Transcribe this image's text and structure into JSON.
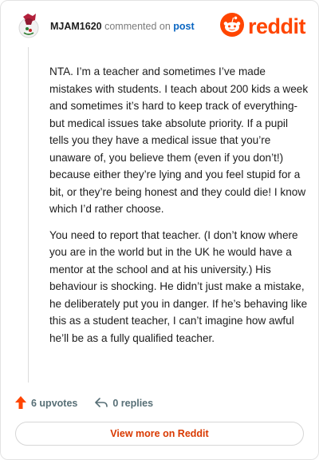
{
  "comment": {
    "username": "MJAM1620",
    "action_text": "commented on",
    "post_link": "post",
    "paragraphs": [
      "NTA. I’m a teacher and sometimes I’ve made mistakes with students. I teach about 200 kids a week and sometimes it’s hard to keep track of everything- but medical issues take absolute priority. If a pupil tells you they have a medical issue that you’re unaware of, you believe them (even if you don’t!) because either they’re lying and you feel stupid for a bit, or they’re being honest and they could die! I know which I’d rather choose.",
      "You need to report that teacher. (I don’t know where you are in the world but in the UK he would have a mentor at the school and at his university.) His behaviour is shocking. He didn’t just make a mistake, he deliberately put you in danger. If he’s behaving like this as a student teacher, I can’t imagine how awful he’ll be as a fully qualified teacher."
    ],
    "upvotes": "6 upvotes",
    "replies": "0 replies"
  },
  "brand": {
    "name": "reddit",
    "color": "#ff4500",
    "icon": "reddit-snoo-icon"
  },
  "footer": {
    "view_more_label": "View more on Reddit"
  },
  "colors": {
    "accent": "#ff4500",
    "link": "#0a66c2",
    "button_text": "#d93900"
  }
}
